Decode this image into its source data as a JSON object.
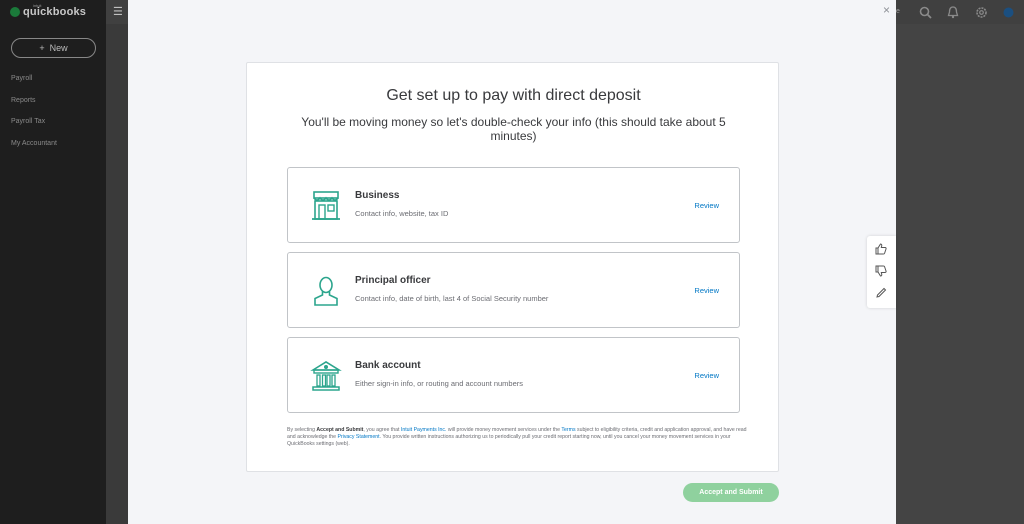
{
  "app": {
    "logo_small": "intuit",
    "logo_text": "quickbooks",
    "new_button": "New",
    "nav": [
      {
        "label": "Payroll"
      },
      {
        "label": "Reports"
      },
      {
        "label": "Payroll Tax"
      },
      {
        "label": "My Accountant"
      }
    ],
    "top_text": "e"
  },
  "modal": {
    "close_glyph": "×",
    "title": "Get set up to pay with direct deposit",
    "subtitle": "You'll be moving money so let's double-check your info (this should take about 5 minutes)",
    "sections": [
      {
        "title": "Business",
        "description": "Contact info, website, tax ID",
        "action": "Review",
        "icon": "storefront-icon"
      },
      {
        "title": "Principal officer",
        "description": "Contact info, date of birth, last 4 of Social Security number",
        "action": "Review",
        "icon": "person-icon"
      },
      {
        "title": "Bank account",
        "description": "Either sign-in info, or routing and account numbers",
        "action": "Review",
        "icon": "bank-icon"
      }
    ],
    "legal": {
      "p1": "By selecting ",
      "bold1": "Accept and Submit",
      "p2": ", you agree that ",
      "link1": "Intuit Payments Inc.",
      "p3": " will provide money movement services under the ",
      "link2": "Terms",
      "p4": " subject to eligibility criteria, credit and application approval, and have read and acknowledge the ",
      "link3": "Privacy Statement",
      "p5": ". You provide written instructions authorizing us to periodically pull your credit report starting now, until you cancel your money movement services in your QuickBooks settings (web)."
    },
    "submit_button": "Accept and Submit"
  },
  "colors": {
    "accent_teal": "#2ca58d",
    "link_blue": "#0077c5",
    "submit_green": "#8fd19e"
  }
}
